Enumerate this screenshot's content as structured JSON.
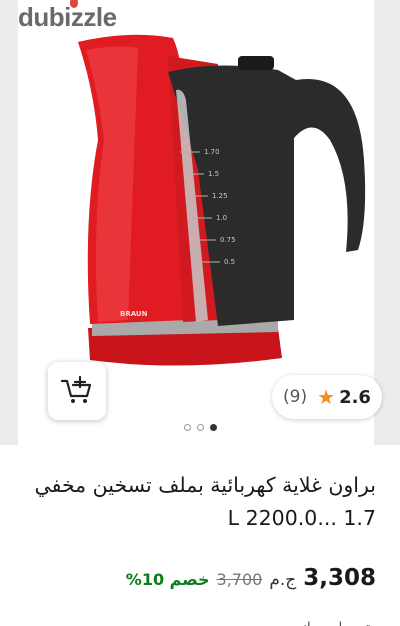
{
  "watermark": {
    "text": "dubizzle"
  },
  "product": {
    "image_icon": "electric-kettle-image",
    "brand_mark": "BRAUN",
    "gauge_marks": [
      "1.70",
      "1.5",
      "1.25",
      "1.0",
      "0.75",
      "0.5"
    ],
    "colors": {
      "body": "#e11b22",
      "handle": "#2b2b2b"
    }
  },
  "cart": {
    "icon": "add-to-cart-icon"
  },
  "rating": {
    "value": "2.6",
    "count": "(9)",
    "star_color": "#f48c15"
  },
  "carousel": {
    "total": 3,
    "active_index": 2
  },
  "listing": {
    "title": "براون غلاية كهربائية بملف تسخين مخفي 1.7 ...L 2200.0",
    "price": "3,308",
    "currency": "ج.م",
    "old_price": "3,700",
    "discount": "خصم 10%",
    "discount_color": "#0c7c1e",
    "footer_partial": "توصيل مجاني"
  }
}
